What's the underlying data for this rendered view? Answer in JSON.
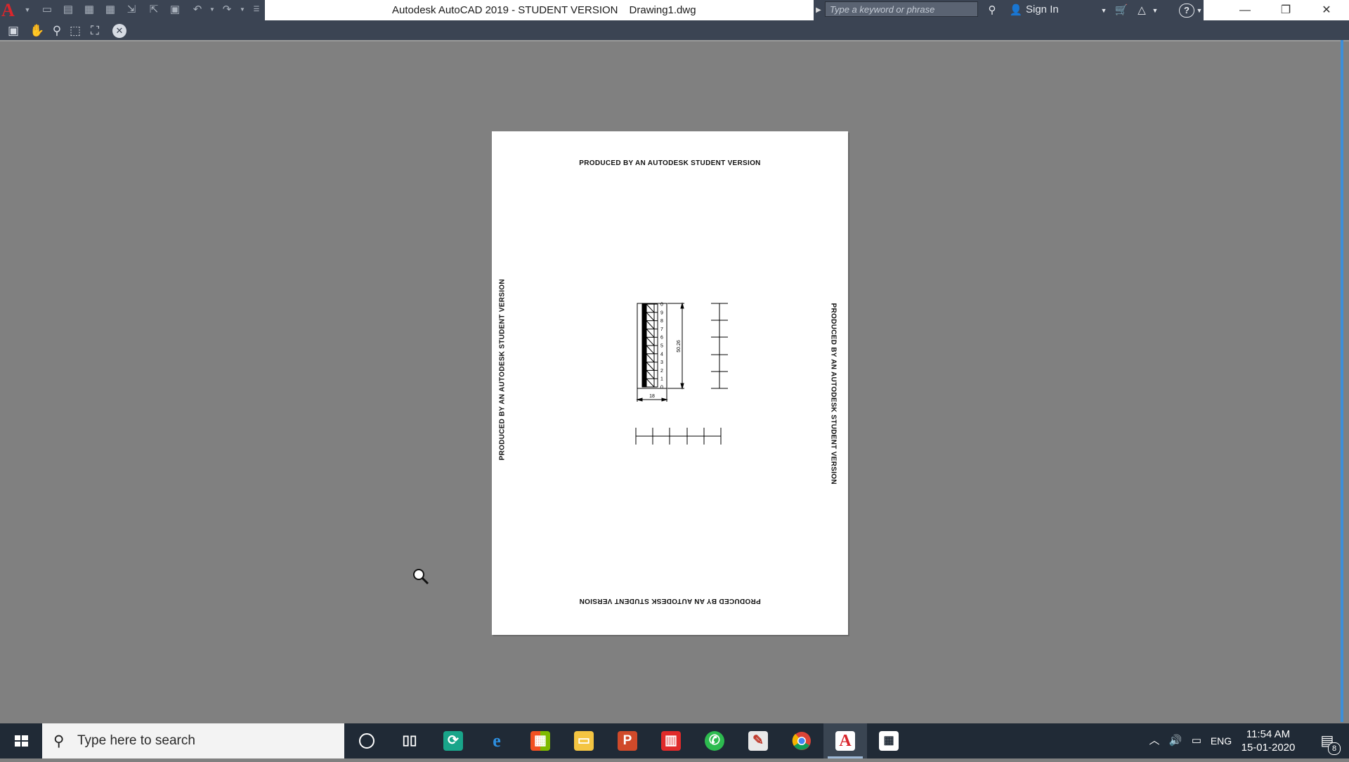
{
  "app": {
    "title": "Autodesk AutoCAD 2019 - STUDENT VERSION",
    "filename": "Drawing1.dwg",
    "logo_letter": "A"
  },
  "help_bar": {
    "search_placeholder": "Type a keyword or phrase",
    "sign_in": "Sign In"
  },
  "quick_access_icons": [
    "new-icon",
    "open-icon",
    "save-icon",
    "save-as-icon",
    "export-icon",
    "publish-icon",
    "plot-icon",
    "undo-icon",
    "redo-icon",
    "customize-icon"
  ],
  "preview_toolbar_icons": [
    "plot-icon",
    "pan-icon",
    "zoom-icon",
    "zoom-window-icon",
    "zoom-original-icon",
    "close-preview-icon"
  ],
  "sheet": {
    "watermark": "PRODUCED BY AN AUTODESK STUDENT VERSION",
    "scale_ticks": [
      "0",
      "9",
      "8",
      "7",
      "6",
      "5",
      "4",
      "3",
      "2",
      "1",
      "0"
    ],
    "dim_height": "50.26",
    "dim_width": "18"
  },
  "taskbar": {
    "search_placeholder": "Type here to search",
    "time": "11:54 AM",
    "date": "15-01-2020",
    "language": "ENG",
    "notifications": "8",
    "apps": [
      "cortana-icon",
      "task-view-icon",
      "sync-app-icon",
      "edge-icon",
      "store-icon",
      "file-explorer-icon",
      "powerpoint-icon",
      "reader-icon",
      "whatsapp-icon",
      "paint-icon",
      "chrome-icon",
      "autocad-icon",
      "calculator-icon"
    ]
  },
  "colors": {
    "ribbon": "#3b4453",
    "canvas": "#808080",
    "autocad_red": "#d9262c",
    "taskbar": "#202a36",
    "accent": "#3d8fd8"
  }
}
